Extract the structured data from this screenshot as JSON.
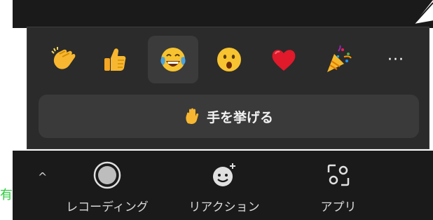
{
  "reactions": {
    "items": [
      {
        "name": "clap",
        "icon": "clapping-hands-icon"
      },
      {
        "name": "thumbs-up",
        "icon": "thumbs-up-icon"
      },
      {
        "name": "laugh",
        "icon": "tears-of-joy-icon",
        "selected": true
      },
      {
        "name": "surprised",
        "icon": "open-mouth-face-icon"
      },
      {
        "name": "heart",
        "icon": "red-heart-icon"
      },
      {
        "name": "party",
        "icon": "party-popper-icon"
      }
    ],
    "more_label": "···",
    "raise_hand_label": "手を挙げる"
  },
  "toolbar": {
    "partial_left_label": "有",
    "caret": "^",
    "items": [
      {
        "label": "レコーディング",
        "icon": "record-icon"
      },
      {
        "label": "リアクション",
        "icon": "reaction-smiley-icon"
      },
      {
        "label": "アプリ",
        "icon": "apps-icon"
      }
    ]
  },
  "colors": {
    "popup_bg": "#2b2b2b",
    "toolbar_bg": "#1a1a1a",
    "button_bg": "#3a3a3a",
    "selected_bg": "#3b3b3b",
    "partial_label_green": "#2ecc40"
  }
}
